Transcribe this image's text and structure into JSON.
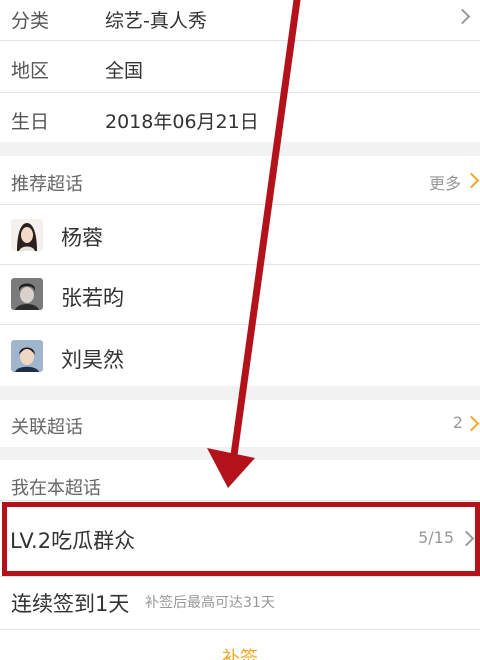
{
  "info": {
    "category_label": "分类",
    "category_value": "综艺-真人秀",
    "region_label": "地区",
    "region_value": "全国",
    "birthday_label": "生日",
    "birthday_value": "2018年06月21日"
  },
  "recommended": {
    "title": "推荐超话",
    "more_label": "更多",
    "items": [
      {
        "name": "杨蓉"
      },
      {
        "name": "张若昀"
      },
      {
        "name": "刘昊然"
      }
    ]
  },
  "related": {
    "title": "关联超话",
    "count": "2"
  },
  "mine": {
    "title": "我在本超话",
    "level_text": "LV.2吃瓜群众",
    "progress": "5/15",
    "streak_text": "连续签到1天",
    "streak_note": "补签后最高可达31天",
    "buqian_label": "补签"
  },
  "colors": {
    "accent": "#f5a623",
    "annotation": "#b3121b"
  }
}
